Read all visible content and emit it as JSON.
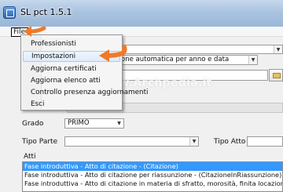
{
  "window": {
    "title": "SL pct 1.5.1"
  },
  "menubar": {
    "file": "File"
  },
  "file_menu": {
    "items": [
      "Professionisti",
      "Impostazioni",
      "Aggiorna certificati",
      "Aggiorna elenco atti",
      "Controllo presenza aggiornamenti",
      "Esci"
    ],
    "highlighted": "Impostazioni"
  },
  "form": {
    "numbering_combo_value": "one automatica per anno e data",
    "section_header": "ALI SOMMARI",
    "grado_label": "Grado",
    "grado_value": "PRIMO",
    "tipo_parte_label": "Tipo Parte",
    "tipo_parte_value": "",
    "tipo_atto_label": "Tipo Atto",
    "tipo_atto_value": "",
    "atti_label": "Atti",
    "atti": [
      "Fase introduttiva - Atto di citazione - (Citazione)",
      "Fase introduttiva - Atto di citazione per riassunzione - (CitazioneInRiassunzione)",
      "Fase introduttiva - Atto di citazione in materia di sfratto, morosità, finita locazione - (Citaz"
    ],
    "atti_selected_index": 0
  },
  "watermark": "www.Archpedia.it",
  "colors": {
    "menu_arrow": "#f07a2a",
    "selection": "#3399ff"
  }
}
